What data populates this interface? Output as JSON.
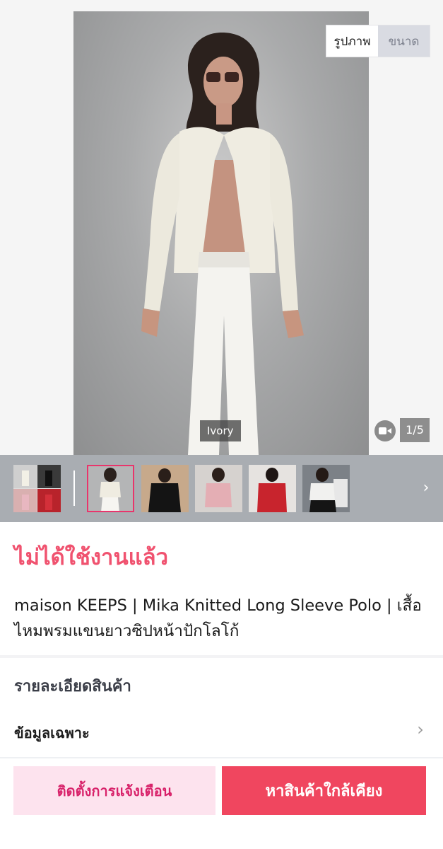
{
  "gallery": {
    "view_toggle": {
      "photos_label": "รูปภาพ",
      "size_label": "ขนาด"
    },
    "color_label": "Ivory",
    "video_icon": "video-camera-icon",
    "page_counter": "1/5",
    "next_icon": "chevron-right-icon"
  },
  "thumbnails": [
    {
      "name": "thumb-collage"
    },
    {
      "name": "thumb-ivory"
    },
    {
      "name": "thumb-black"
    },
    {
      "name": "thumb-pink"
    },
    {
      "name": "thumb-red"
    },
    {
      "name": "thumb-white-black"
    }
  ],
  "product": {
    "status": "ไม่ได้ใช้งานแล้ว",
    "title": "maison KEEPS | Mika Knitted Long Sleeve Polo | เสื้อไหมพรมแขนยาวซิปหน้าปักโลโก้"
  },
  "details": {
    "heading": "รายละเอียดสินค้า",
    "spec_label": "ข้อมูลเฉพาะ",
    "spec_chevron": "›"
  },
  "actions": {
    "notify_label": "ติดตั้งการแจ้งเตือน",
    "find_nearby_label": "หาสินค้าใกล้เคียง"
  },
  "colors": {
    "accent": "#f0465f",
    "status_text": "#f0526f",
    "notify_bg": "#fde3ee",
    "notify_text": "#d8226a",
    "thumb_selected_border": "#e8356c"
  }
}
